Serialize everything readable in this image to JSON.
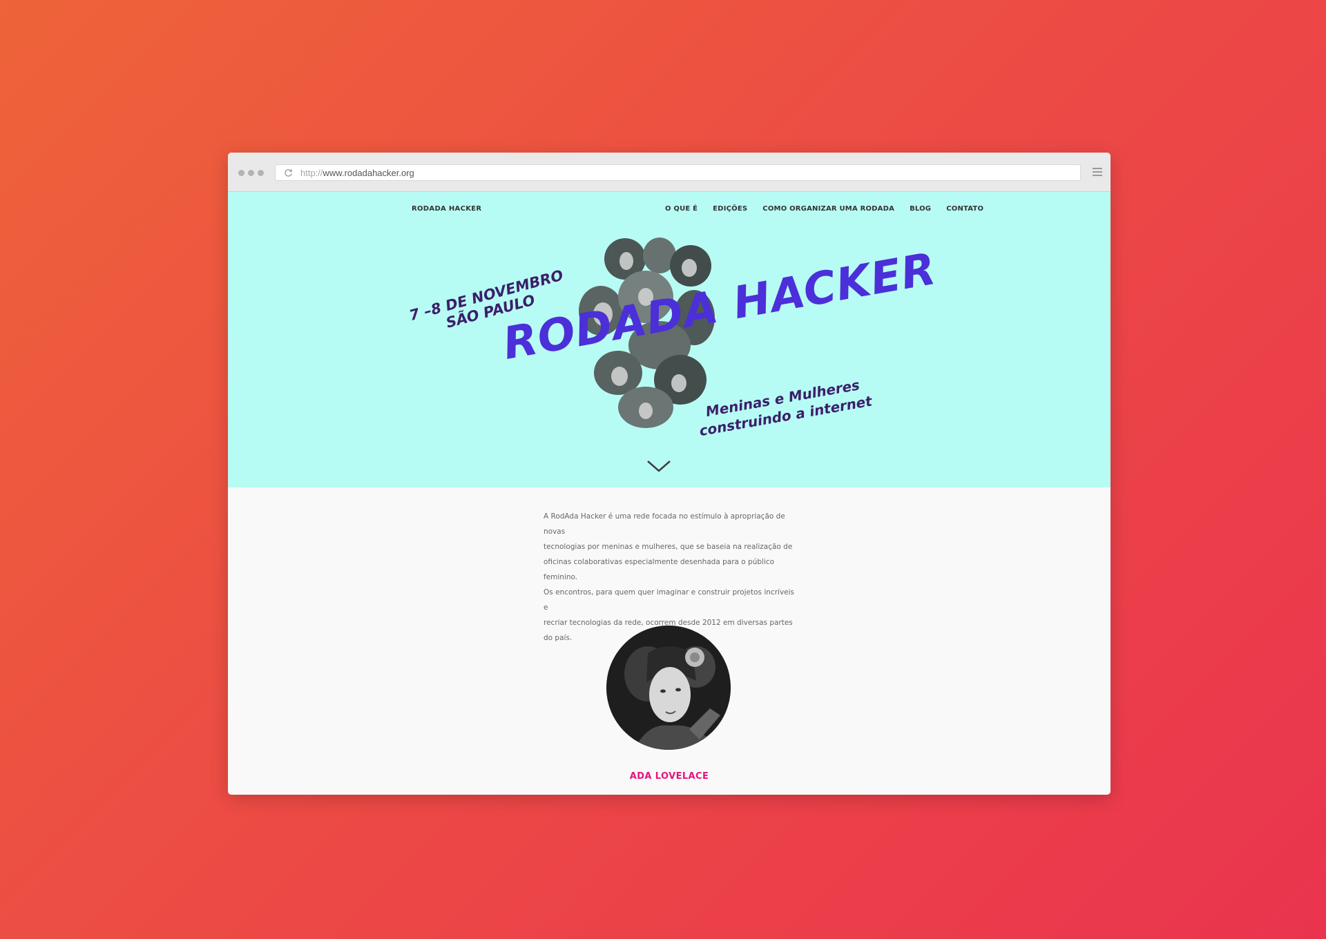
{
  "browser": {
    "url_protocol": "http://",
    "url_domain": "www.rodadahacker.org"
  },
  "nav": {
    "brand": "RODADA HACKER",
    "items": [
      "O QUE É",
      "EDIÇÕES",
      "COMO ORGANIZAR UMA RODADA",
      "BLOG",
      "CONTATO"
    ]
  },
  "hero": {
    "date_line1": "7 –8 DE NOVEMBRO",
    "date_line2": "SÃO PAULO",
    "title": "RODADA HACKER",
    "tagline_line1": "Meninas e Mulheres",
    "tagline_line2": "construindo a internet"
  },
  "intro": {
    "lines": [
      "A RodAda Hacker é uma rede focada no estímulo à apropriação de novas",
      "tecnologias por meninas e mulheres, que se baseia na realização de",
      "oficinas colaborativas especialmente desenhada para o público feminino.",
      "Os encontros, para quem quer imaginar e construir projetos incríveis e",
      "recriar tecnologias da rede, ocorrem desde 2012 em diversas partes do país."
    ]
  },
  "featured": {
    "name": "ADA LOVELACE"
  },
  "colors": {
    "background_start": "#ee6339",
    "background_end": "#ea344e",
    "hero_bg": "#b7fcf4",
    "title": "#4b2fd8",
    "accent_pink": "#e8127c"
  }
}
